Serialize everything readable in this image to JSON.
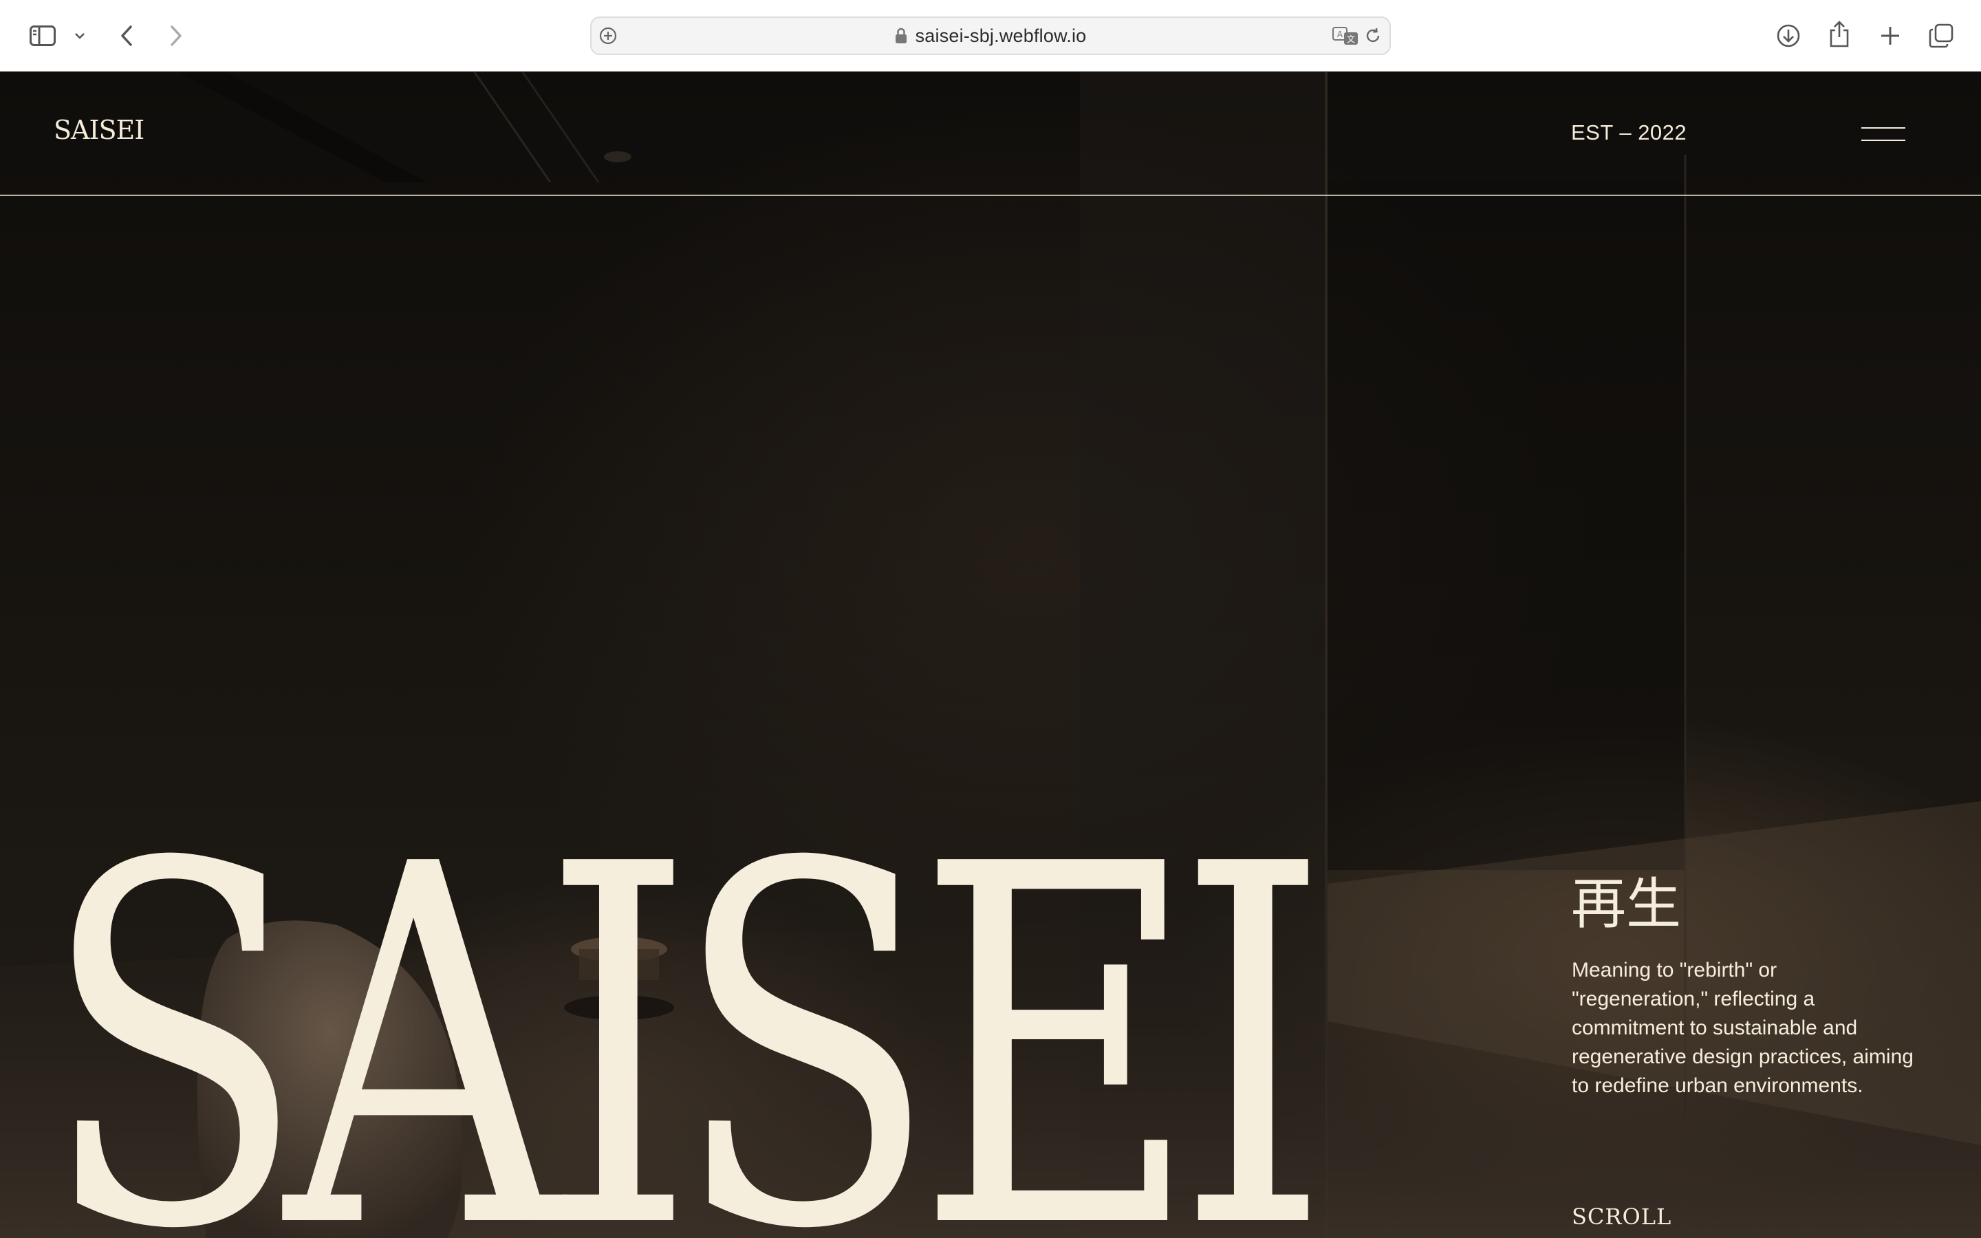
{
  "browser": {
    "url": "saisei-sbj.webflow.io",
    "icons": [
      "sidebar-icon",
      "chevron-down-icon",
      "back-icon",
      "forward-icon",
      "add-tab-circle-icon",
      "lock-icon",
      "translate-icon",
      "reload-icon",
      "download-icon",
      "share-icon",
      "new-tab-icon",
      "tabs-overview-icon"
    ]
  },
  "header": {
    "logo": "SAISEI",
    "est": "EST – 2022",
    "menu_icon": "hamburger-menu-icon"
  },
  "hero": {
    "title": "SAISEI",
    "kanji": "再生",
    "description": "Meaning to \"rebirth\" or \"regeneration,\" reflecting a commitment to sustainable and regenerative design practices, aiming to redefine urban environments.",
    "scroll_label": "SCROLL"
  },
  "colors": {
    "text_cream": "#f6eedc",
    "background_dark": "#16130f",
    "chrome_bg": "#ffffff"
  }
}
